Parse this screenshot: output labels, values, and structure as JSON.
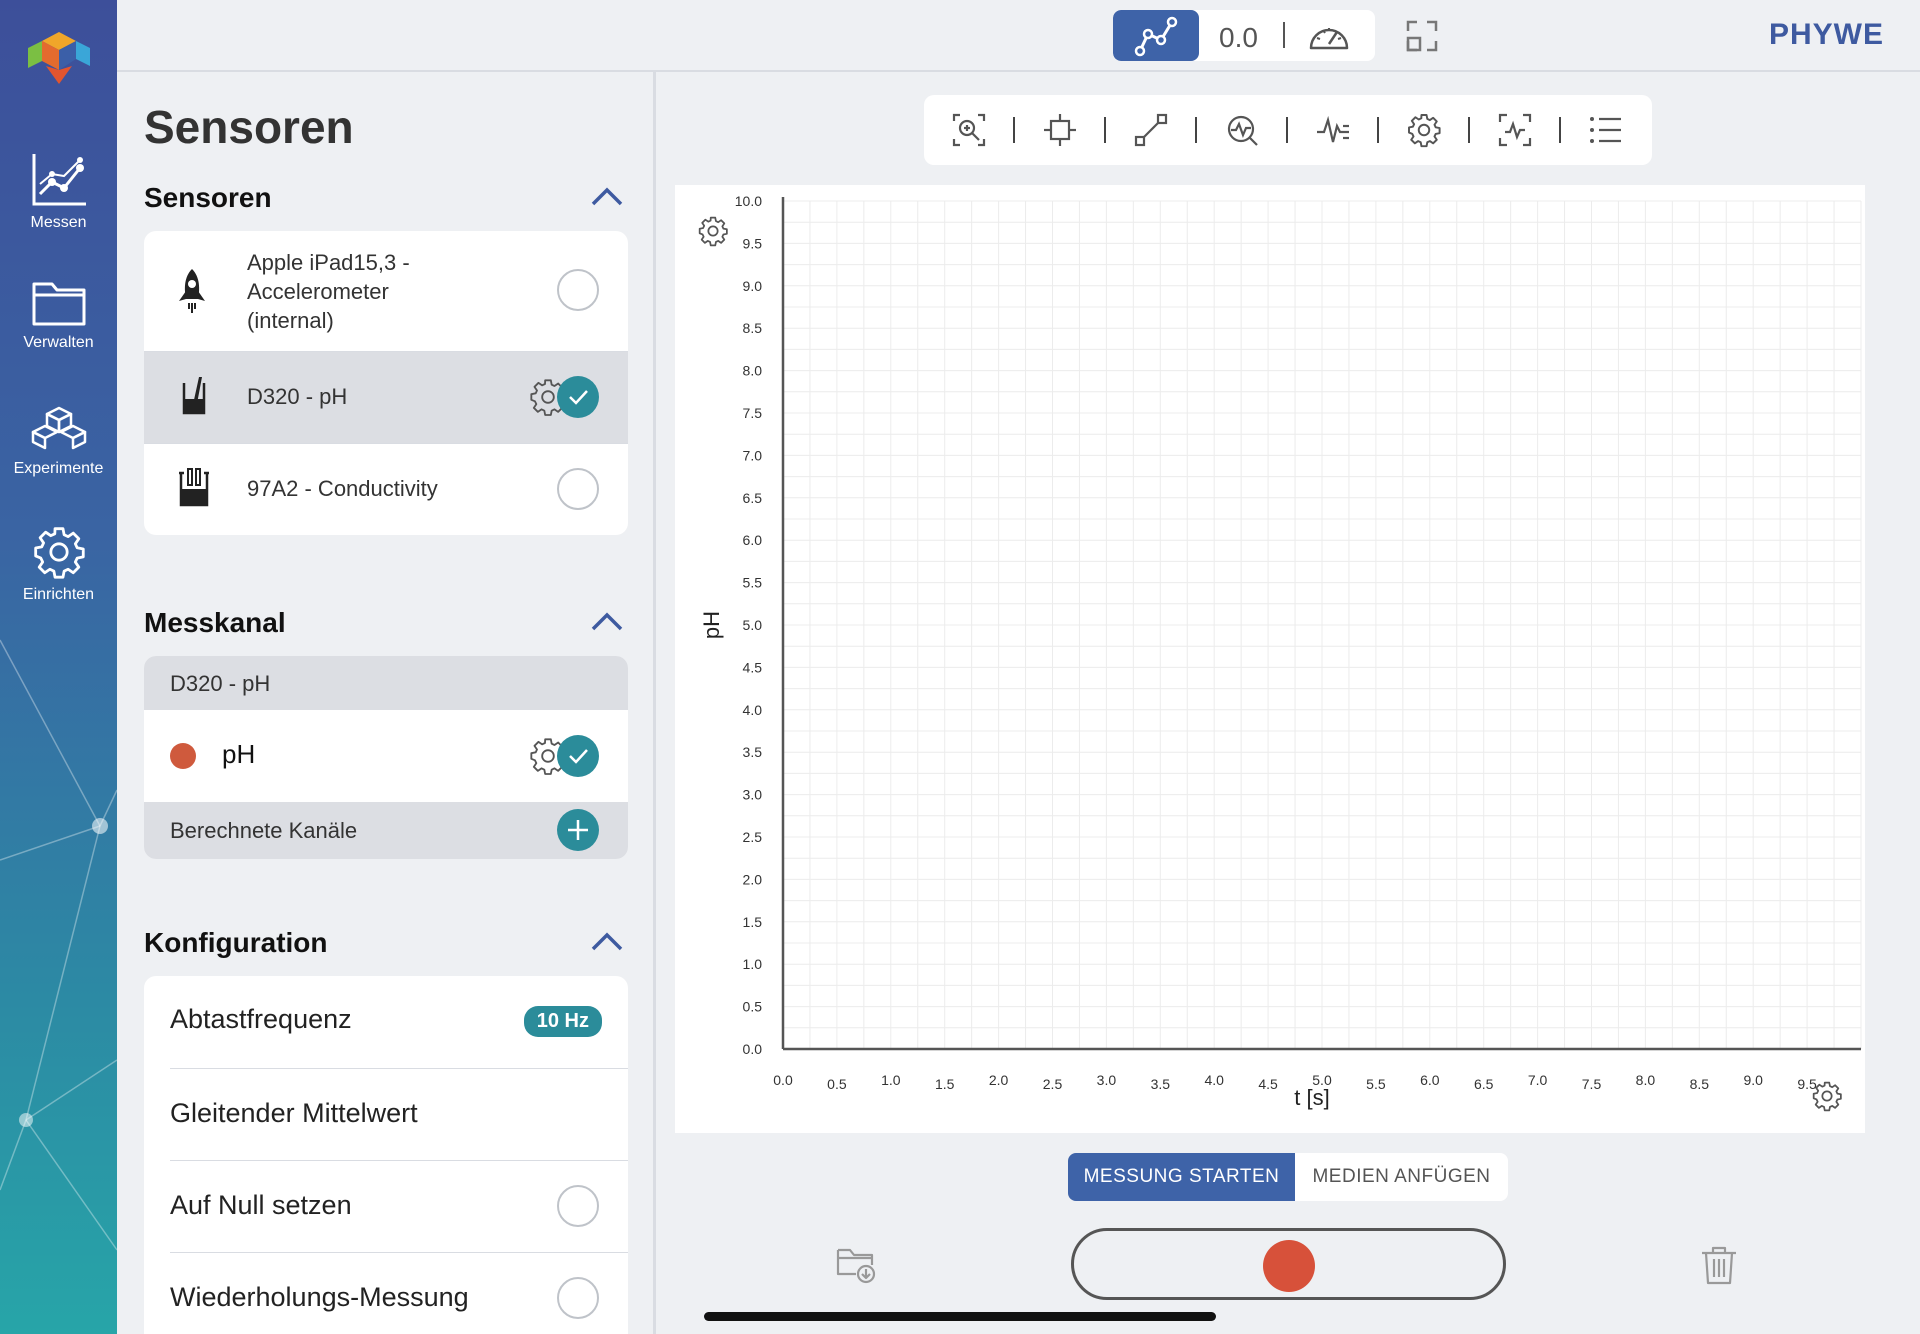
{
  "brand": "PHYWE",
  "nav": {
    "items": [
      {
        "label": "Messen",
        "icon": "chart-line-icon"
      },
      {
        "label": "Verwalten",
        "icon": "folder-icon"
      },
      {
        "label": "Experimente",
        "icon": "cubes-icon"
      },
      {
        "label": "Einrichten",
        "icon": "gear-icon"
      }
    ]
  },
  "topbar": {
    "value_display": "0.0",
    "modes": [
      "graph",
      "numeric",
      "gauge"
    ],
    "active_mode": "graph"
  },
  "panel": {
    "title": "Sensoren",
    "sensors": {
      "heading": "Sensoren",
      "items": [
        {
          "name": "Apple iPad15,3 - Accelerometer (internal)",
          "line1": "Apple iPad15,3 -",
          "line2": "Accelerometer",
          "line3": "(internal)",
          "selected": false,
          "icon": "rocket-icon"
        },
        {
          "name": "D320 - pH",
          "selected": true,
          "icon": "ph-probe-icon"
        },
        {
          "name": "97A2 - Conductivity",
          "selected": false,
          "icon": "conductivity-beaker-icon"
        }
      ]
    },
    "channel": {
      "heading": "Messkanal",
      "group_label": "D320 - pH",
      "channel_label": "pH",
      "channel_color": "#cf5a3d",
      "channel_selected": true,
      "computed_label": "Berechnete Kanäle"
    },
    "config": {
      "heading": "Konfiguration",
      "sample_rate_label": "Abtastfrequenz",
      "sample_rate_value": "10 Hz",
      "moving_avg_label": "Gleitender Mittelwert",
      "zero_label": "Auf Null setzen",
      "repeat_label": "Wiederholungs-Messung"
    }
  },
  "controls": {
    "start_label": "MESSUNG STARTEN",
    "media_label": "MEDIEN ANFÜGEN"
  },
  "colors": {
    "accent": "#3e63a8",
    "teal": "#2b8c9a",
    "record": "#d7513a"
  },
  "chart_data": {
    "type": "line",
    "title": "",
    "xlabel": "t [s]",
    "ylabel": "pH",
    "xlim": [
      0,
      10
    ],
    "ylim": [
      0,
      10
    ],
    "x_ticks": [
      "0.0",
      "0.5",
      "1.0",
      "1.5",
      "2.0",
      "2.5",
      "3.0",
      "3.5",
      "4.0",
      "4.5",
      "5.0",
      "5.5",
      "6.0",
      "6.5",
      "7.0",
      "7.5",
      "8.0",
      "8.5",
      "9.0",
      "9.5"
    ],
    "y_ticks": [
      "0.0",
      "0.5",
      "1.0",
      "1.5",
      "2.0",
      "2.5",
      "3.0",
      "3.5",
      "4.0",
      "4.5",
      "5.0",
      "5.5",
      "6.0",
      "6.5",
      "7.0",
      "7.5",
      "8.0",
      "8.5",
      "9.0",
      "9.5",
      "10.0"
    ],
    "series": [],
    "grid": true
  }
}
